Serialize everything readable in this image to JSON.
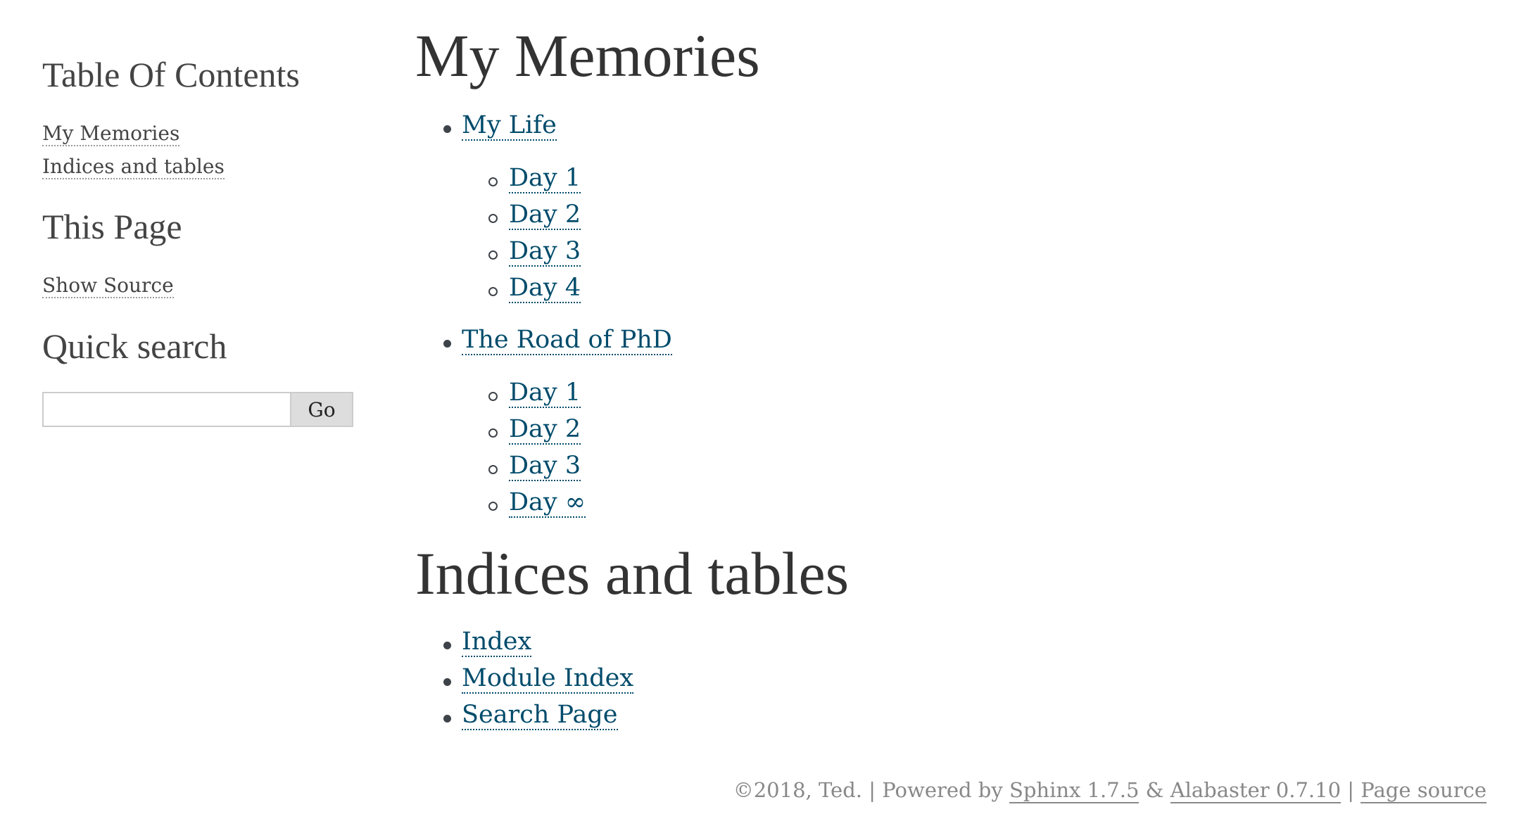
{
  "sidebar": {
    "toc_title": "Table Of Contents",
    "toc_links": [
      "My Memories",
      "Indices and tables"
    ],
    "this_page_title": "This Page",
    "show_source": "Show Source",
    "quick_search_title": "Quick search",
    "search_input_value": "",
    "search_button": "Go"
  },
  "main": {
    "sections": [
      {
        "title": "My Memories",
        "items": [
          {
            "label": "My Life",
            "children": [
              "Day 1",
              "Day 2",
              "Day 3",
              "Day 4"
            ]
          },
          {
            "label": "The Road of PhD",
            "children": [
              "Day 1",
              "Day 2",
              "Day 3",
              "Day ∞"
            ]
          }
        ]
      },
      {
        "title": "Indices and tables",
        "items": [
          {
            "label": "Index"
          },
          {
            "label": "Module Index"
          },
          {
            "label": "Search Page"
          }
        ]
      }
    ]
  },
  "footer": {
    "copyright": "©2018, Ted.",
    "sep1": " | Powered by ",
    "sphinx": "Sphinx 1.7.5",
    "amp": " & ",
    "alabaster": "Alabaster 0.7.10",
    "sep2": " | ",
    "page_source": "Page source"
  },
  "colors": {
    "link": "#004b6b",
    "text": "#3e4349",
    "muted": "#888888"
  }
}
